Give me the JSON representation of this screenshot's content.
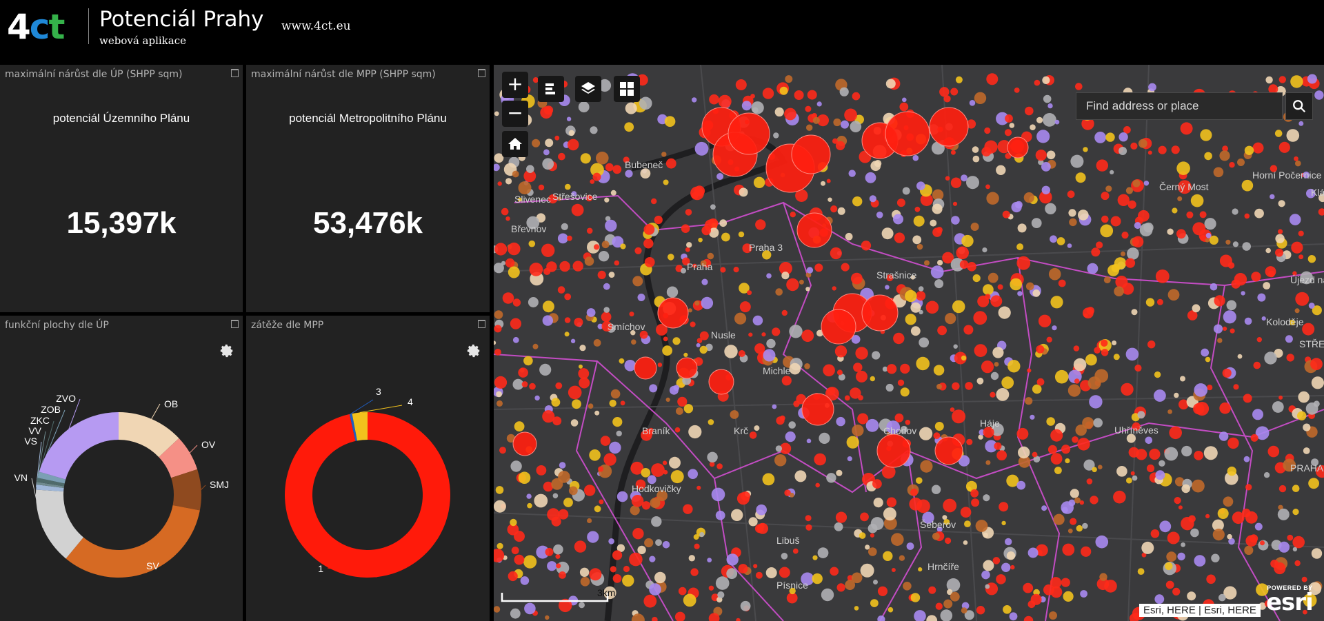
{
  "header": {
    "logo": {
      "four": "4",
      "c": "c",
      "t": "t"
    },
    "title": "Potenciál Prahy",
    "subtitle": "webová aplikace",
    "link": "www.4ct.eu"
  },
  "panels": {
    "up_indicator": {
      "title": "maximální nárůst dle ÚP (SHPP sqm)",
      "subtitle": "potenciál Územního Plánu",
      "value": "15,397k"
    },
    "mpp_indicator": {
      "title": "maximální nárůst dle MPP (SHPP sqm)",
      "subtitle": "potenciál Metropolitního Plánu",
      "value": "53,476k"
    },
    "up_chart": {
      "title": "funkční plochy dle ÚP"
    },
    "mpp_chart": {
      "title": "zátěže dle MPP"
    }
  },
  "chart_data": [
    {
      "type": "pie",
      "title": "funkční plochy dle ÚP",
      "categories": [
        "OB",
        "OV",
        "SMJ",
        "SV",
        "VN",
        "VS",
        "VV",
        "ZKC",
        "ZOB",
        "ZVO"
      ],
      "values": [
        13,
        7,
        8,
        33,
        15,
        1,
        0.5,
        0.8,
        1.2,
        20.5
      ],
      "colors": [
        "#f0d6b4",
        "#f59086",
        "#8f4a1f",
        "#d66a23",
        "#d2d2d2",
        "#9fb7d8",
        "#6f8a8e",
        "#4f6b6b",
        "#7b9fb4",
        "#b69af2"
      ]
    },
    {
      "type": "pie",
      "title": "zátěže dle MPP",
      "categories": [
        "1",
        "3",
        "4"
      ],
      "values": [
        96.5,
        0.5,
        3
      ],
      "colors": [
        "#ff1a0a",
        "#1f5fc4",
        "#f2c21d"
      ]
    }
  ],
  "map": {
    "labels": [
      "Bubeneč",
      "Střešovice",
      "Břevnov",
      "Praha 3",
      "Praha",
      "Strašnice",
      "Smíchov",
      "Nusle",
      "Michle",
      "Braník",
      "Krč",
      "Hodkovičky",
      "Libuš",
      "Písnice",
      "Chodov",
      "Háje",
      "Šeberov",
      "Hrnčíře",
      "Uhříněves",
      "Koloděje",
      "Újezd nad Lesy",
      "Horní Počernice",
      "Černý Most",
      "Klánovice",
      "Slivenec",
      "STŘEDOČESKÝ KRAJ",
      "PRAHA"
    ],
    "search_placeholder": "Find address or place",
    "scale": "3km",
    "attribution": "Esri, HERE | Esri, HERE",
    "powered_by": "POWERED BY",
    "esri": "esri",
    "zoom_in": "+",
    "zoom_out": "−"
  }
}
